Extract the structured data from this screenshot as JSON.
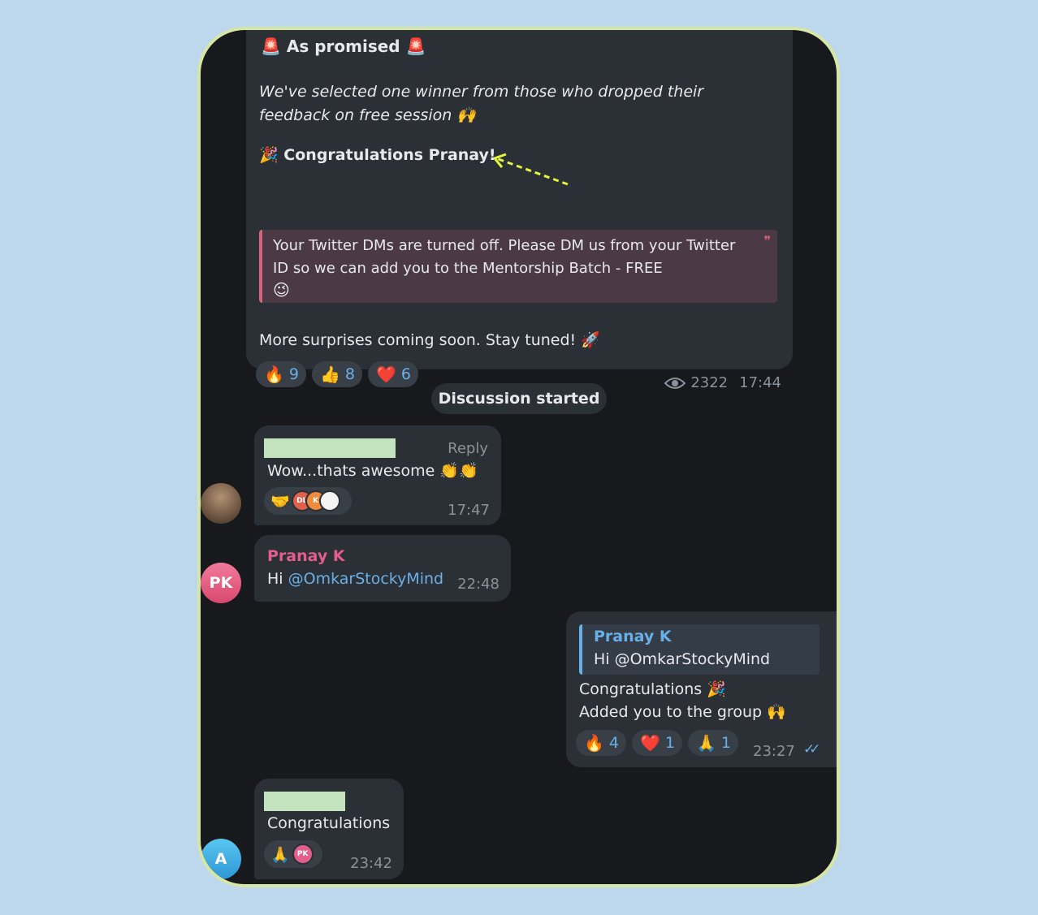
{
  "channel_post": {
    "heading": "As promised",
    "heading_emoji_left": "🚨",
    "heading_emoji_right": "🚨",
    "intro": "We've selected one winner from those who dropped their feedback on free session 🙌",
    "congrats_emoji": "🎉",
    "congrats": "Congratulations Pranay!",
    "quote": "Your Twitter DMs are turned off. Please DM us from your Twitter ID so we can add you to the Mentorship Batch - FREE",
    "quote_emoji": "😉",
    "quote_mark": "❞",
    "footer_text": "More surprises coming soon. Stay tuned! 🚀",
    "reactions": [
      {
        "emoji": "🔥",
        "count": "9"
      },
      {
        "emoji": "👍",
        "count": "8"
      },
      {
        "emoji": "❤️",
        "count": "6"
      }
    ],
    "views": "2322",
    "time": "17:44"
  },
  "service_message": "Discussion started",
  "messages": [
    {
      "text": "Wow...thats awesome 👏👏",
      "reply_label": "Reply",
      "reaction_emoji": "🤝",
      "reactor_initials": [
        "DL",
        "K",
        ""
      ],
      "time": "17:47"
    },
    {
      "sender": "Pranay K",
      "text_prefix": "Hi ",
      "mention": "@OmkarStockyMind",
      "time": "22:48",
      "avatar_initials": "PK"
    },
    {
      "reply_sender": "Pranay K",
      "reply_text": "Hi @OmkarStockyMind",
      "line1": "Congratulations 🎉",
      "line2": "Added you to the group 🙌",
      "reactions": [
        {
          "emoji": "🔥",
          "count": "4"
        },
        {
          "emoji": "❤️",
          "count": "1"
        },
        {
          "emoji": "🙏",
          "count": "1"
        }
      ],
      "time": "23:27",
      "status_icon": "✓✓"
    },
    {
      "text": "Congratulations",
      "reaction_emoji": "🙏",
      "reactor_initials": "PK",
      "time": "23:42",
      "avatar_initials": "A"
    }
  ],
  "colors": {
    "background": "#bdd7ec",
    "chat_bg": "#18191d",
    "bubble": "#2b2f36",
    "accent_blue": "#6ab0e8",
    "sender_pink": "#e35e8c",
    "quote_bar": "#d8637e",
    "annotation_arrow": "#e5f53b",
    "redaction": "#c3e3bf"
  }
}
